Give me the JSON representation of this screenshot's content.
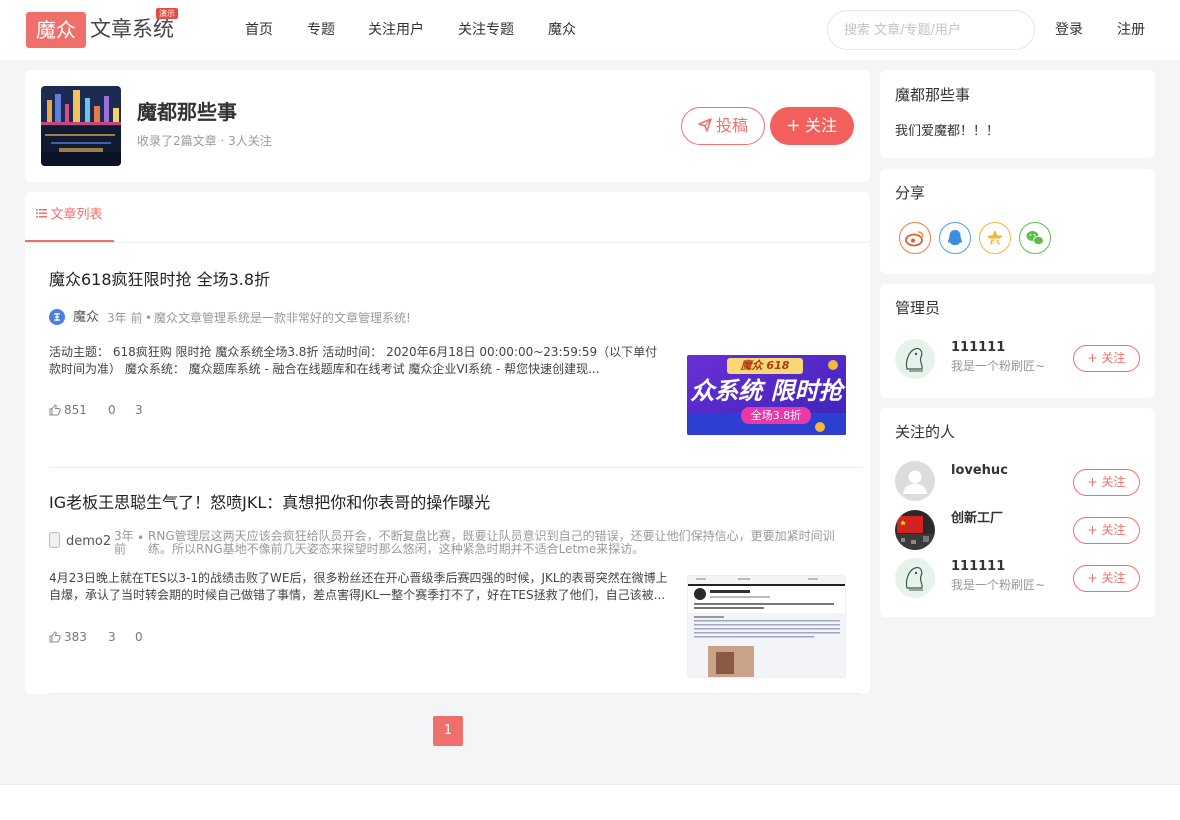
{
  "header": {
    "logo_box": "魔众",
    "logo_text": "文章系统",
    "logo_badge": "演示",
    "nav": [
      "首页",
      "专题",
      "关注用户",
      "关注专题",
      "魔众"
    ],
    "search_placeholder": "搜索 文章/专题/用户",
    "login": "登录",
    "register": "注册"
  },
  "topic": {
    "title": "魔都那些事",
    "meta": "收录了2篇文章 · 3人关注",
    "submit_label": "投稿",
    "follow_label": "关注",
    "submit_icon": "paper-plane-icon",
    "follow_icon": "plus-icon"
  },
  "list": {
    "tab_label": "文章列表",
    "articles": [
      {
        "title": "魔众618疯狂限时抢 全场3.8折",
        "author": "魔众",
        "time": "3年 前",
        "summary": "魔众文章管理系统是一款非常好的文章管理系统!",
        "excerpt": "活动主题： 618疯狂购 限时抢 魔众系统全场3.8折 活动时间： 2020年6月18日 00:00:00~23:59:59（以下单付款时间为准） 魔众系统： 魔众题库系统 - 融合在线题库和在线考试 魔众企业VI系统 - 帮您快速创建现...",
        "likes": "851",
        "comments": "0",
        "views": "3",
        "thumb_title": "魔众 618",
        "thumb_big": "众系统 限时抢",
        "thumb_sub": "全场3.8折"
      },
      {
        "title": "IG老板王思聪生气了！怒喷JKL：真想把你和你表哥的操作曝光",
        "author": "demo2",
        "time": "3年 前",
        "summary": "RNG管理层这两天应该会疯狂给队员开会，不断复盘比赛，既要让队员意识到自己的错误，还要让他们保持信心，更要加紧时间训练。所以RNG基地不像前几天姿态来探望时那么悠闲，这种紧急时期并不适合Letme来探访。",
        "excerpt": "4月23日晚上就在TES以3-1的战绩击败了WE后，很多粉丝还在开心晋级季后赛四强的时候，JKL的表哥突然在微博上自爆，承认了当时转会期的时候自己做错了事情，差点害得JKL一整个赛季打不了，好在TES拯救了他们，自己该被...",
        "likes": "383",
        "comments": "3",
        "views": "0"
      }
    ]
  },
  "sidebar": {
    "topic_title": "魔都那些事",
    "topic_desc": "我们爱魔都！！！",
    "share_title": "分享",
    "share_icons": [
      "weibo-icon",
      "qq-icon",
      "qzone-icon",
      "wechat-icon"
    ],
    "admin_title": "管理员",
    "admin": {
      "name": "111111",
      "sub": "我是一个粉刷匠~",
      "follow": "关注"
    },
    "followers_title": "关注的人",
    "followers": [
      {
        "name": "lovehuc",
        "sub": "",
        "follow": "关注"
      },
      {
        "name": "创新工厂",
        "sub": "",
        "follow": "关注"
      },
      {
        "name": "111111",
        "sub": "我是一个粉刷匠~",
        "follow": "关注"
      }
    ]
  },
  "pagination": {
    "current": "1"
  },
  "colors": {
    "accent": "#ef6f6a",
    "accent_strong": "#f25f5c"
  }
}
